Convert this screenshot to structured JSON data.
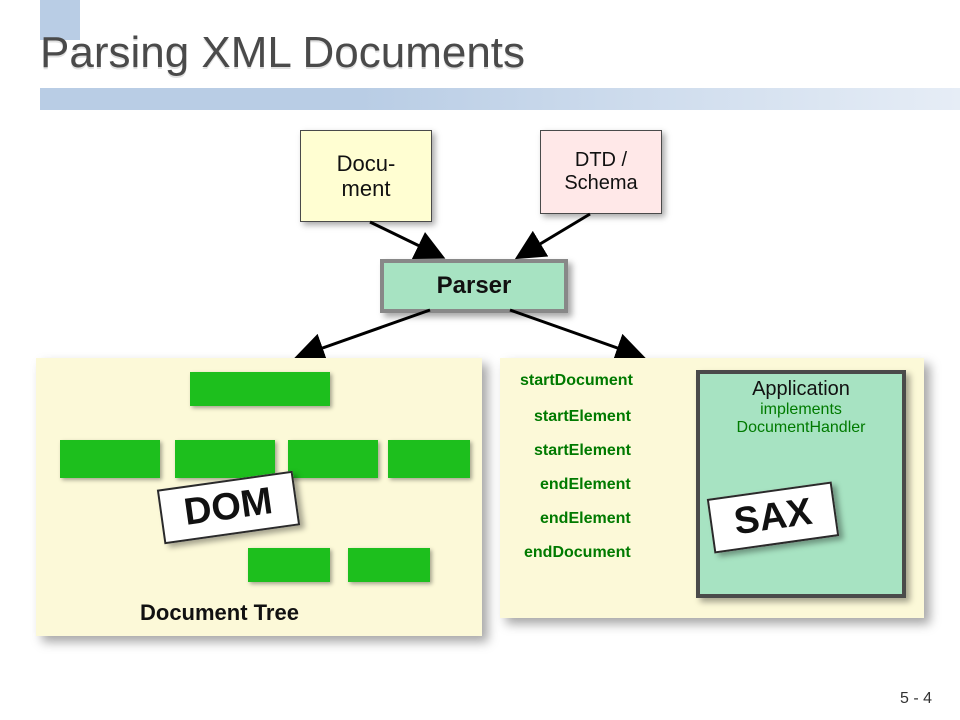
{
  "title": "Parsing XML Documents",
  "page_number": "5 - 4",
  "inputs": {
    "document_label": "Docu-\nment",
    "dtd_label": "DTD /\nSchema"
  },
  "parser_label": "Parser",
  "left": {
    "caption": "Document Tree",
    "callout": "DOM"
  },
  "right": {
    "callout": "SAX",
    "application": {
      "title": "Application",
      "sub1": "implements",
      "sub2": "DocumentHandler"
    },
    "events": [
      "startDocument",
      "startElement",
      "startElement",
      "endElement",
      "endElement",
      "endDocument"
    ]
  },
  "colors": {
    "accent_light_blue": "#b9cde5",
    "panel_cream": "#fcf9d8",
    "node_green": "#1dbf1d",
    "parser_green": "#a7e3c2",
    "doc_yellow": "#fffed2",
    "dtd_pink": "#ffe8e8",
    "event_green": "#007a00"
  }
}
